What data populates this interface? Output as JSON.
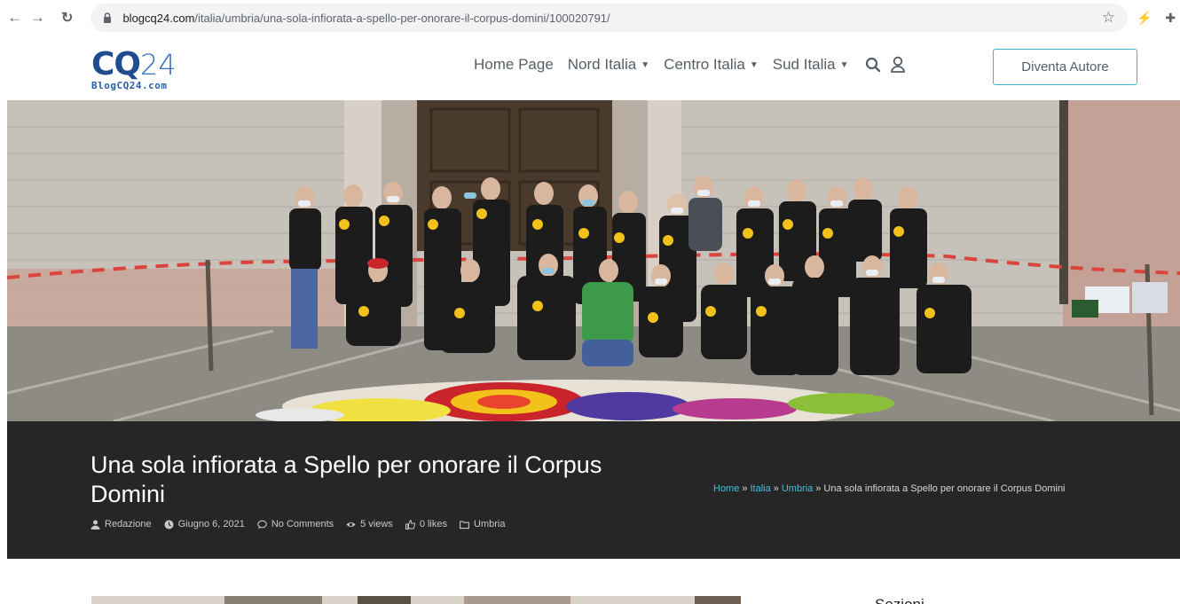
{
  "browser": {
    "url_domain": "blogcq24.com",
    "url_path": "/italia/umbria/una-sola-infiorata-a-spello-per-onorare-il-corpus-domini/100020791/"
  },
  "header": {
    "logo_main": "CQ",
    "logo_num": "24",
    "logo_sub": "BlogCQ24.com",
    "nav": [
      {
        "label": "Home Page",
        "dropdown": false
      },
      {
        "label": "Nord Italia",
        "dropdown": true
      },
      {
        "label": "Centro Italia",
        "dropdown": true
      },
      {
        "label": "Sud Italia",
        "dropdown": true
      }
    ],
    "author_button": "Diventa Autore"
  },
  "post": {
    "title": "Una sola infiorata a Spello per onorare il Corpus Domini",
    "meta": {
      "author": "Redazione",
      "date": "Giugno 6, 2021",
      "comments": "No Comments",
      "views": "5 views",
      "likes": "0 likes",
      "category": "Umbria"
    },
    "breadcrumb": {
      "home": "Home",
      "italia": "Italia",
      "umbria": "Umbria",
      "current": "Una sola infiorata a Spello per onorare il Corpus Domini",
      "separator": "»"
    }
  },
  "sidebar": {
    "heading": "Sezioni"
  },
  "colors": {
    "brand_dark_blue": "#1f4c8f",
    "brand_blue": "#3a6fc0",
    "accent_teal": "#3fb6c7",
    "title_band": "#262626",
    "breadcrumb_link": "#3ec3dc"
  },
  "icons": {
    "back": "arrow-left-icon",
    "forward": "arrow-right-icon",
    "reload": "reload-icon",
    "lock": "lock-icon",
    "bookmark": "star-icon",
    "extension1": "lightning-icon",
    "extension2": "puzzle-icon",
    "search": "search-icon",
    "user": "user-icon",
    "author": "user-icon",
    "date": "clock-icon",
    "comments": "comment-icon",
    "views": "eye-icon",
    "likes": "thumbs-up-icon",
    "category": "folder-icon"
  }
}
